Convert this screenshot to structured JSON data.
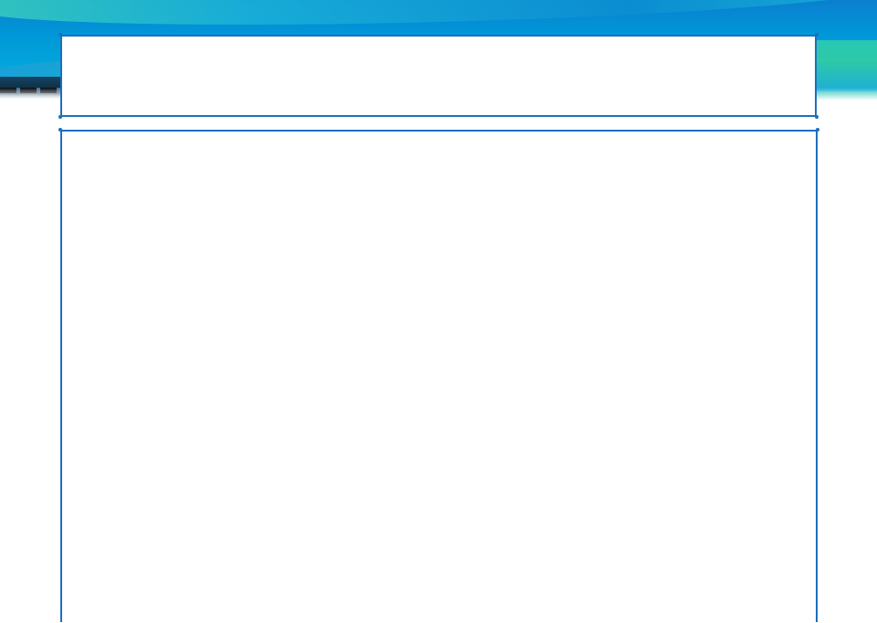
{
  "slide": {
    "title_text": "",
    "body_text": ""
  },
  "colors": {
    "frame_border": "#1f6fbd",
    "band_primary": "#0098d8",
    "band_accent_teal": "#2ec9a7",
    "background": "#ffffff"
  }
}
